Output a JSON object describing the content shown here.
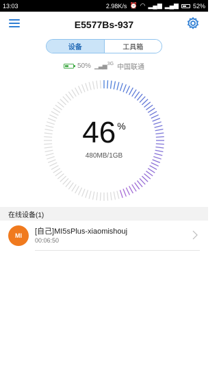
{
  "status_bar": {
    "time": "13:03",
    "network_speed": "2.98K/s",
    "battery_percent": "52%"
  },
  "header": {
    "title": "E5577Bs-937"
  },
  "tabs": [
    {
      "label": "设备",
      "active": true
    },
    {
      "label": "工具箱",
      "active": false
    }
  ],
  "info": {
    "battery": "50%",
    "network_type": "3G",
    "carrier": "中国联通",
    "battery_level": 0.5
  },
  "gauge": {
    "percent": "46",
    "percent_sign": "%",
    "usage": "480MB/1GB",
    "fraction": 0.46,
    "colors": {
      "start": "#4a7fd8",
      "end": "#a86bd6",
      "track": "#dcdcdc"
    }
  },
  "online_devices": {
    "heading": "在线设备(1)",
    "items": [
      {
        "avatar_text": "MI",
        "name": "[自己]MI5sPlus-xiaomishouj",
        "duration": "00:06:50"
      }
    ]
  },
  "colors": {
    "accent": "#2f7fd4",
    "avatar": "#f07a1e"
  }
}
